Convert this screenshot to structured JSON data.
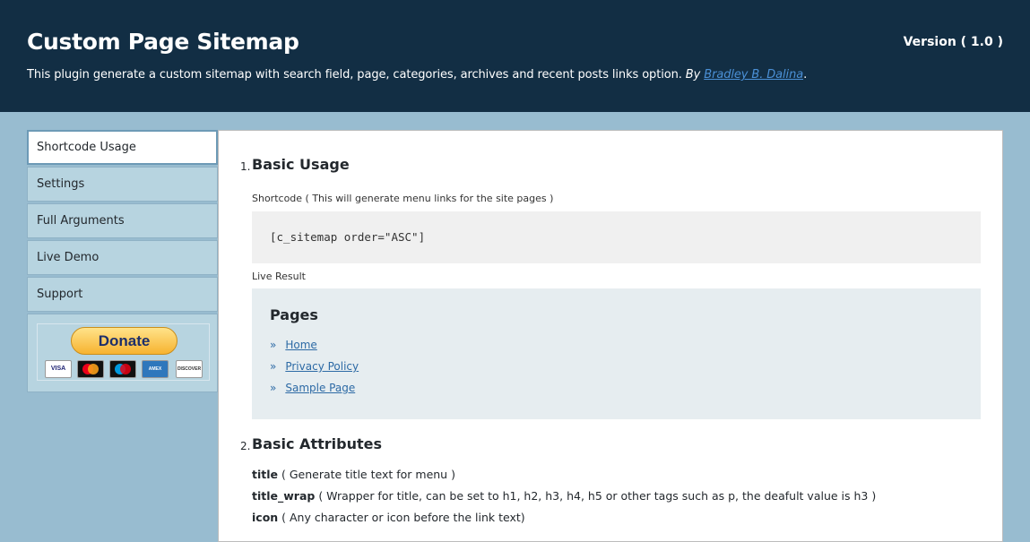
{
  "header": {
    "title": "Custom Page Sitemap",
    "version": "Version ( 1.0 )",
    "description": "This plugin generate a custom sitemap with search field, page, categories, archives and recent posts links option.",
    "by_label": "By",
    "author": "Bradley B. Dalina",
    "period": "."
  },
  "nav": {
    "items": [
      {
        "label": "Shortcode Usage"
      },
      {
        "label": "Settings"
      },
      {
        "label": "Full Arguments"
      },
      {
        "label": "Live Demo"
      },
      {
        "label": "Support"
      }
    ],
    "donate_label": "Donate",
    "cards": [
      "VISA",
      "MC",
      "MAESTRO",
      "AMEX",
      "DISCOVER"
    ]
  },
  "content": {
    "section1": {
      "number": "1.",
      "title": "Basic Usage",
      "shortcode_caption": "Shortcode ( This will generate menu links for the site pages )",
      "code": "[c_sitemap order=\"ASC\"]",
      "live_result_label": "Live Result",
      "result": {
        "heading": "Pages",
        "links": [
          "Home",
          "Privacy Policy",
          "Sample Page"
        ],
        "bullet": "»"
      }
    },
    "section2": {
      "number": "2.",
      "title": "Basic Attributes",
      "attrs": [
        {
          "name": "title",
          "desc": " ( Generate title text for menu )"
        },
        {
          "name": "title_wrap",
          "desc": " ( Wrapper for title, can be set to h1, h2, h3, h4, h5 or other tags such as p, the deafult value is h3 )"
        },
        {
          "name": "icon",
          "desc": " ( Any character or icon before the link text)"
        }
      ]
    }
  },
  "colors": {
    "header_bg": "#122e44",
    "page_bg": "#98bcd0",
    "link": "#2d6aa5"
  }
}
